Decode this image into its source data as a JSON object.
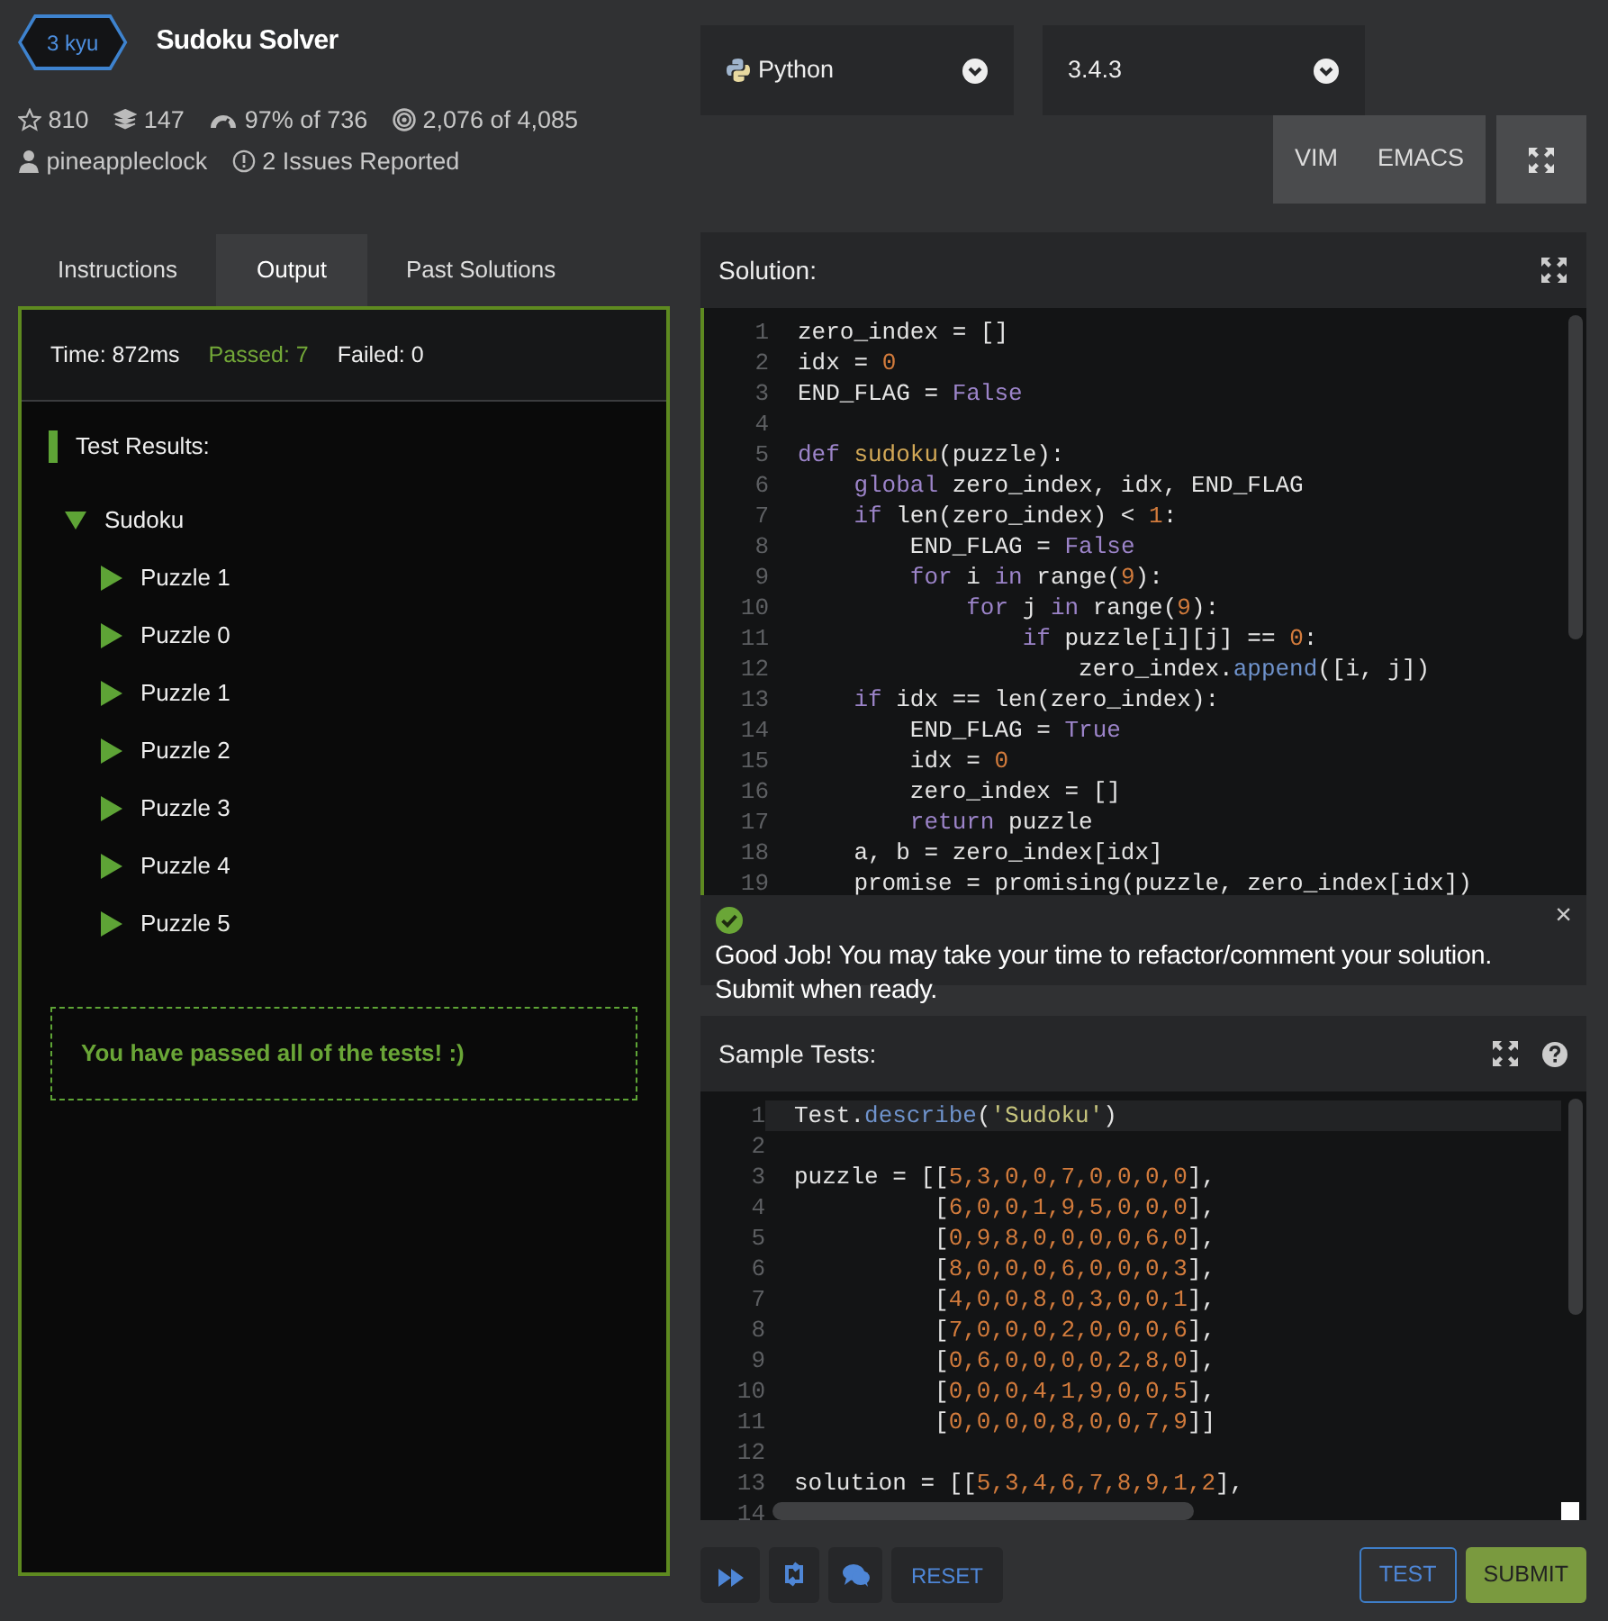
{
  "kata": {
    "rank": "3 kyu",
    "title": "Sudoku Solver",
    "stats": [
      {
        "kind": "stars",
        "text": "810"
      },
      {
        "kind": "collections",
        "text": "147"
      },
      {
        "kind": "satisfaction",
        "text": "97% of 736"
      },
      {
        "kind": "completed",
        "text": "2,076 of 4,085"
      },
      {
        "kind": "author",
        "text": "pineappleclock"
      },
      {
        "kind": "issues",
        "text": "2 Issues Reported"
      }
    ]
  },
  "language": {
    "value": "Python"
  },
  "version": {
    "value": "3.4.3"
  },
  "modes": [
    "VIM",
    "EMACS"
  ],
  "tabs": [
    {
      "label": "Instructions",
      "selected": false
    },
    {
      "label": "Output",
      "selected": true
    },
    {
      "label": "Past Solutions",
      "selected": false
    }
  ],
  "output": {
    "summary": [
      {
        "kind": "time",
        "text": "Time: 872ms"
      },
      {
        "kind": "passed",
        "text": "Passed: 7"
      },
      {
        "kind": "failed",
        "text": "Failed: 0"
      }
    ],
    "heading": "Test Results:",
    "tree": [
      {
        "label": "Sudoku",
        "expanded": true,
        "children": [
          {
            "label": "Puzzle 1",
            "expanded": false
          },
          {
            "label": "Puzzle 0",
            "expanded": false
          },
          {
            "label": "Puzzle 1",
            "expanded": false
          },
          {
            "label": "Puzzle 2",
            "expanded": false
          },
          {
            "label": "Puzzle 3",
            "expanded": false
          },
          {
            "label": "Puzzle 4",
            "expanded": false
          },
          {
            "label": "Puzzle 5",
            "expanded": false
          }
        ]
      }
    ],
    "message": "You have passed all of the tests! :)"
  },
  "solution": {
    "title": "Solution:",
    "lines": [
      {
        "n": "1",
        "tokens": [
          {
            "kind": "plain",
            "text": "zero_index = []"
          }
        ]
      },
      {
        "n": "2",
        "tokens": [
          {
            "kind": "plain",
            "text": "idx = "
          },
          {
            "kind": "number",
            "text": "0"
          }
        ]
      },
      {
        "n": "3",
        "tokens": [
          {
            "kind": "plain",
            "text": "END_FLAG = "
          },
          {
            "kind": "keyword",
            "text": "False"
          }
        ]
      },
      {
        "n": "4"
      },
      {
        "n": "5",
        "tokens": [
          {
            "kind": "keyword",
            "text": "def"
          },
          {
            "kind": "function",
            "text": " sudoku"
          },
          {
            "kind": "plain",
            "text": "(puzzle):"
          }
        ]
      },
      {
        "n": "6",
        "tokens": [
          {
            "kind": "keyword",
            "text": "    global"
          },
          {
            "kind": "plain",
            "text": " zero_index, idx, END_FLAG"
          }
        ]
      },
      {
        "n": "7",
        "tokens": [
          {
            "kind": "keyword",
            "text": "    if"
          },
          {
            "kind": "plain",
            "text": " len(zero_index) < "
          },
          {
            "kind": "number",
            "text": "1"
          },
          {
            "kind": "plain",
            "text": ":"
          }
        ]
      },
      {
        "n": "8",
        "tokens": [
          {
            "kind": "plain",
            "text": "        END_FLAG = "
          },
          {
            "kind": "keyword",
            "text": "False"
          }
        ]
      },
      {
        "n": "9",
        "tokens": [
          {
            "kind": "keyword",
            "text": "        for"
          },
          {
            "kind": "plain",
            "text": " i "
          },
          {
            "kind": "keyword",
            "text": "in"
          },
          {
            "kind": "plain",
            "text": " range("
          },
          {
            "kind": "number",
            "text": "9"
          },
          {
            "kind": "plain",
            "text": "):"
          }
        ]
      },
      {
        "n": "10",
        "tokens": [
          {
            "kind": "keyword",
            "text": "            for"
          },
          {
            "kind": "plain",
            "text": " j "
          },
          {
            "kind": "keyword",
            "text": "in"
          },
          {
            "kind": "plain",
            "text": " range("
          },
          {
            "kind": "number",
            "text": "9"
          },
          {
            "kind": "plain",
            "text": "):"
          }
        ]
      },
      {
        "n": "11",
        "tokens": [
          {
            "kind": "keyword",
            "text": "                if"
          },
          {
            "kind": "plain",
            "text": " puzzle[i][j] == "
          },
          {
            "kind": "number",
            "text": "0"
          },
          {
            "kind": "plain",
            "text": ":"
          }
        ]
      },
      {
        "n": "12",
        "tokens": [
          {
            "kind": "plain",
            "text": "                    zero_index."
          },
          {
            "kind": "method",
            "text": "append"
          },
          {
            "kind": "plain",
            "text": "([i, j])"
          }
        ]
      },
      {
        "n": "13",
        "tokens": [
          {
            "kind": "keyword",
            "text": "    if"
          },
          {
            "kind": "plain",
            "text": " idx == len(zero_index):"
          }
        ]
      },
      {
        "n": "14",
        "tokens": [
          {
            "kind": "plain",
            "text": "        END_FLAG = "
          },
          {
            "kind": "keyword",
            "text": "True"
          }
        ]
      },
      {
        "n": "15",
        "tokens": [
          {
            "kind": "plain",
            "text": "        idx = "
          },
          {
            "kind": "number",
            "text": "0"
          }
        ]
      },
      {
        "n": "16",
        "tokens": [
          {
            "kind": "plain",
            "text": "        zero_index = []"
          }
        ]
      },
      {
        "n": "17",
        "tokens": [
          {
            "kind": "keyword",
            "text": "        return"
          },
          {
            "kind": "plain",
            "text": " puzzle"
          }
        ]
      },
      {
        "n": "18",
        "tokens": [
          {
            "kind": "plain",
            "text": "    a, b = zero_index[idx]"
          }
        ]
      },
      {
        "n": "19",
        "tokens": [
          {
            "kind": "plain",
            "text": "    promise = promising(puzzle, zero_index[idx])"
          }
        ]
      }
    ]
  },
  "alert": {
    "text": "Good Job! You may take your time to refactor/comment your solution. Submit when ready.",
    "close": "×"
  },
  "sample_tests": {
    "title": "Sample Tests:",
    "lines": [
      {
        "n": "1",
        "active": true,
        "tokens": [
          {
            "kind": "plain",
            "text": "Test."
          },
          {
            "kind": "method",
            "text": "describe"
          },
          {
            "kind": "plain",
            "text": "("
          },
          {
            "kind": "string",
            "text": "'Sudoku'"
          },
          {
            "kind": "plain",
            "text": ")"
          }
        ]
      },
      {
        "n": "2"
      },
      {
        "n": "3",
        "tokens": [
          {
            "kind": "plain",
            "text": "puzzle = [["
          },
          {
            "kind": "number",
            "text": "5,3,0,0,7,0,0,0,0"
          },
          {
            "kind": "plain",
            "text": "],"
          }
        ]
      },
      {
        "n": "4",
        "tokens": [
          {
            "kind": "plain",
            "text": "          ["
          },
          {
            "kind": "number",
            "text": "6,0,0,1,9,5,0,0,0"
          },
          {
            "kind": "plain",
            "text": "],"
          }
        ]
      },
      {
        "n": "5",
        "tokens": [
          {
            "kind": "plain",
            "text": "          ["
          },
          {
            "kind": "number",
            "text": "0,9,8,0,0,0,0,6,0"
          },
          {
            "kind": "plain",
            "text": "],"
          }
        ]
      },
      {
        "n": "6",
        "tokens": [
          {
            "kind": "plain",
            "text": "          ["
          },
          {
            "kind": "number",
            "text": "8,0,0,0,6,0,0,0,3"
          },
          {
            "kind": "plain",
            "text": "],"
          }
        ]
      },
      {
        "n": "7",
        "tokens": [
          {
            "kind": "plain",
            "text": "          ["
          },
          {
            "kind": "number",
            "text": "4,0,0,8,0,3,0,0,1"
          },
          {
            "kind": "plain",
            "text": "],"
          }
        ]
      },
      {
        "n": "8",
        "tokens": [
          {
            "kind": "plain",
            "text": "          ["
          },
          {
            "kind": "number",
            "text": "7,0,0,0,2,0,0,0,6"
          },
          {
            "kind": "plain",
            "text": "],"
          }
        ]
      },
      {
        "n": "9",
        "tokens": [
          {
            "kind": "plain",
            "text": "          ["
          },
          {
            "kind": "number",
            "text": "0,6,0,0,0,0,2,8,0"
          },
          {
            "kind": "plain",
            "text": "],"
          }
        ]
      },
      {
        "n": "10",
        "tokens": [
          {
            "kind": "plain",
            "text": "          ["
          },
          {
            "kind": "number",
            "text": "0,0,0,4,1,9,0,0,5"
          },
          {
            "kind": "plain",
            "text": "],"
          }
        ]
      },
      {
        "n": "11",
        "tokens": [
          {
            "kind": "plain",
            "text": "          ["
          },
          {
            "kind": "number",
            "text": "0,0,0,0,8,0,0,7,9"
          },
          {
            "kind": "plain",
            "text": "]]"
          }
        ]
      },
      {
        "n": "12"
      },
      {
        "n": "13",
        "tokens": [
          {
            "kind": "plain",
            "text": "solution = [["
          },
          {
            "kind": "number",
            "text": "5,3,4,6,7,8,9,1,2"
          },
          {
            "kind": "plain",
            "text": "],"
          }
        ]
      },
      {
        "n": "14"
      }
    ]
  },
  "reset": "RESET",
  "test": "TEST",
  "submit": "SUBMIT"
}
